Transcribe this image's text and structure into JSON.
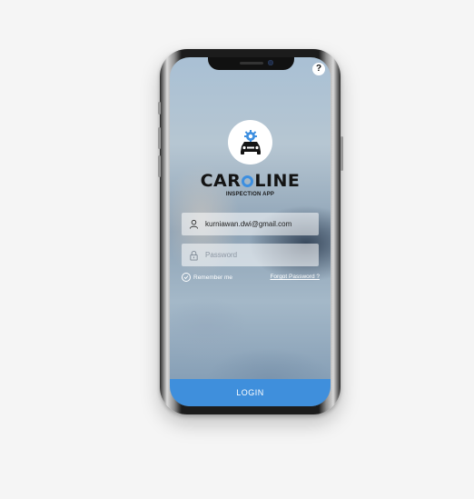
{
  "help_button": {
    "label": "?",
    "icon": "help-icon"
  },
  "brand": {
    "name_prefix": "CAR",
    "name_suffix": "LINE",
    "subtitle": "INSPECTION APP",
    "accent_color": "#3d8fe0"
  },
  "form": {
    "email": {
      "value": "kurniawan.dwi@gmail.com",
      "icon": "user-icon"
    },
    "password": {
      "placeholder": "Password",
      "icon": "lock-icon"
    },
    "remember_label": "Remember me",
    "forgot_label": "Forgot Password ?"
  },
  "login": {
    "label": "LOGIN",
    "color": "#3f8fdc"
  }
}
